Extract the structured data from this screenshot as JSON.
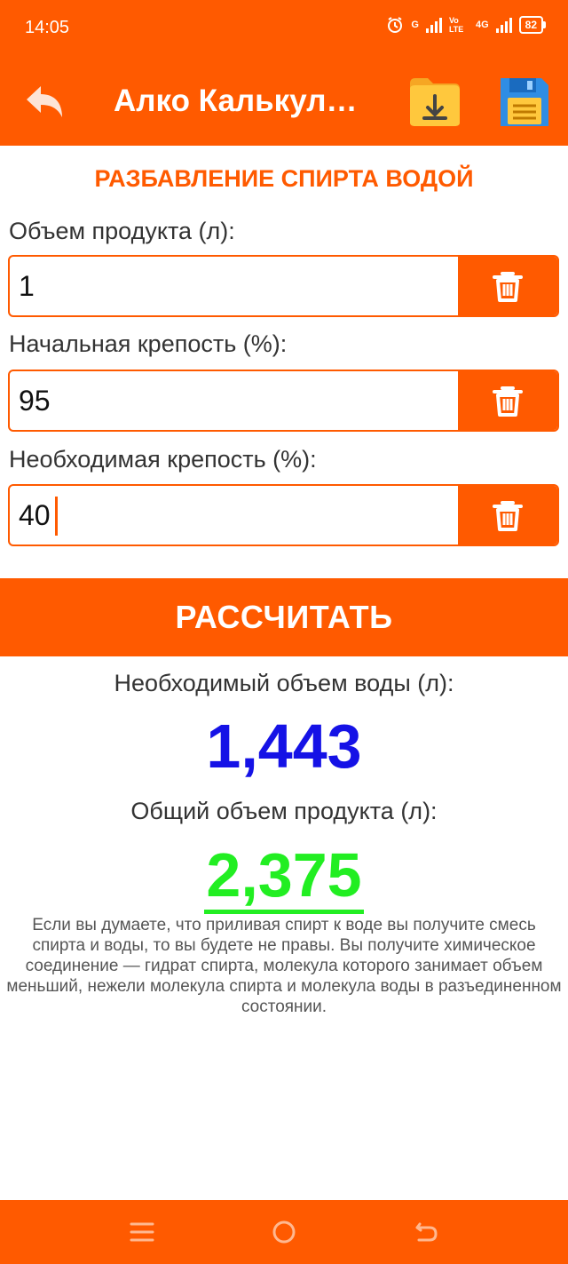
{
  "status_bar": {
    "time": "14:05",
    "network_1": "G",
    "network_2": "Vo LTE",
    "network_3": "4G",
    "battery": "82"
  },
  "app_bar": {
    "title": "Алко Калькулятор",
    "back_icon": "back-arrow-icon",
    "open_icon": "folder-download-icon",
    "save_icon": "floppy-disk-icon"
  },
  "section_title": "РАЗБАВЛЕНИЕ СПИРТА ВОДОЙ",
  "fields": [
    {
      "label": "Объем продукта (л):",
      "value": "1"
    },
    {
      "label": "Начальная крепость (%):",
      "value": "95"
    },
    {
      "label": "Необходимая крепость (%):",
      "value": "40"
    }
  ],
  "calculate_label": "РАССЧИТАТЬ",
  "results": {
    "water_label": "Необходимый объем воды (л):",
    "water_value": "1,443",
    "total_label": "Общий объем продукта (л):",
    "total_value": "2,375"
  },
  "note": "Если вы думаете, что приливая спирт к воде вы получите смесь спирта и воды, то вы будете не правы. Вы получите химическое соединение — гидрат спирта, молекула которого занимает объем меньший, нежели молекула спирта и молекула воды в разъединенном состоянии.",
  "colors": {
    "accent": "#ff5a00",
    "water_value": "#1512e6",
    "total_value": "#22ee22"
  },
  "nav_bar": {
    "menu_icon": "menu-icon",
    "home_icon": "home-circle-icon",
    "back_icon": "nav-back-icon"
  }
}
